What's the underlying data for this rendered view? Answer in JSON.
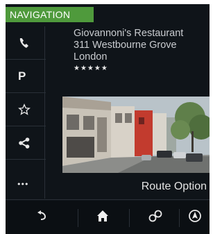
{
  "header": {
    "badge": "NAVIGATION"
  },
  "poi": {
    "name": "Giovannoni's Restaurant",
    "address_line1": "311 Westbourne Grove",
    "address_line2": "London",
    "rating_stars": "★★★★★"
  },
  "sidebar": {
    "items": [
      {
        "icon": "phone-icon"
      },
      {
        "icon": "parking-icon",
        "label": "P"
      },
      {
        "icon": "star-outline-icon"
      },
      {
        "icon": "share-icon"
      },
      {
        "icon": "more-icon",
        "label": "•••"
      }
    ]
  },
  "actions": {
    "route_options": "Route Option"
  },
  "bottom_bar": {
    "items": [
      {
        "icon": "back-icon"
      },
      {
        "icon": "home-icon"
      },
      {
        "icon": "link-icon"
      },
      {
        "icon": "navigation-icon"
      }
    ]
  },
  "colors": {
    "accent": "#4f9a3c",
    "background": "#0f1419"
  }
}
